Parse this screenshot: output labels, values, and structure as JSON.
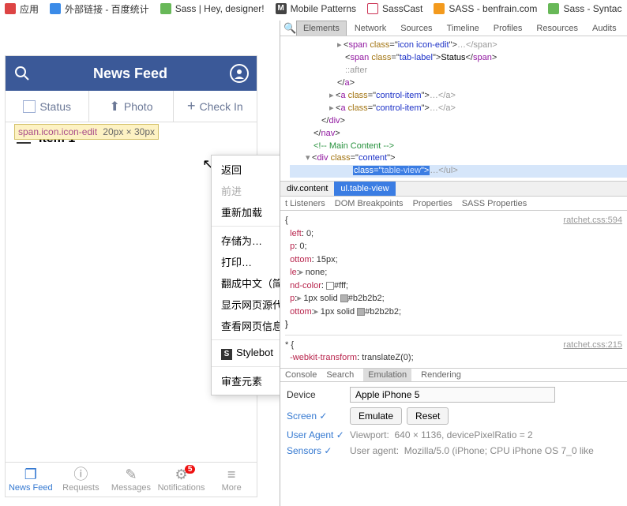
{
  "bookmarks": [
    {
      "color": "#d44",
      "label": "应用"
    },
    {
      "color": "#3b8be8",
      "label": "外部链接 - 百度统计"
    },
    {
      "color": "#68b858",
      "label": "Sass | Hey, designer!"
    },
    {
      "color": "#444",
      "label": "Mobile Patterns",
      "letter": "M"
    },
    {
      "color": "#c35",
      "label": "SassCast"
    },
    {
      "color": "#f39a1d",
      "label": "SASS - benfrain.com"
    },
    {
      "color": "#68b858",
      "label": "Sass - Syntac"
    }
  ],
  "phone": {
    "title": "News Feed",
    "seg": [
      "Status",
      "Photo",
      "Check In"
    ],
    "sel_tooltip_tag": "span.icon.icon-edit",
    "sel_tooltip_dim": "20px × 30px",
    "item": "Item 1",
    "tabs": [
      "News Feed",
      "Requests",
      "Messages",
      "Notifications",
      "More"
    ],
    "badge": "5"
  },
  "ctx": {
    "back": "返回",
    "forward": "前进",
    "reload": "重新加载",
    "saveas": "存储为…",
    "print": "打印…",
    "translate": "翻成中文（简体中文）",
    "viewsrc": "显示网页源代码",
    "pageinfo": "查看网页信息",
    "stylebot": "Stylebot",
    "inspect": "审查元素"
  },
  "dt": {
    "tabs": [
      "Elements",
      "Network",
      "Sources",
      "Timeline",
      "Profiles",
      "Resources",
      "Audits"
    ],
    "dom": {
      "l1a": "<span class=\"icon icon-edit\">",
      "l1b": "…</span>",
      "l2a": "<span class=\"tab-label\">",
      "l2b": "Status",
      "l2c": "</span>",
      "l3": "::after",
      "l4": "</a>",
      "l5a": "<a class=\"control-item\">",
      "l5b": "…</a>",
      "l6": "</div>",
      "l7": "</nav>",
      "l8": "<!-- Main Content -->",
      "l9a": "<div class=\"content\">",
      "l10a": "class=\"table-view\">",
      "l10b": "…</ul>"
    },
    "crumbs": [
      "div.content",
      "ul.table-view"
    ],
    "style_tabs": [
      "t Listeners",
      "DOM Breakpoints",
      "Properties",
      "SASS Properties"
    ],
    "css1": {
      "src": "ratchet.css:594",
      "sel": "{",
      "p1": "left",
      "v1": "0;",
      "p2": "p",
      "v2": "0;",
      "p3": "ottom",
      "v3": "15px;",
      "p4": "le",
      "v4": "none;",
      "p5": "nd-color",
      "v5": "#fff;",
      "p6": "p",
      "v6": "1px solid",
      "v6b": "#b2b2b2;",
      "p7": "ottom",
      "v7": "1px solid",
      "v7b": "#b2b2b2;"
    },
    "css2": {
      "src": "ratchet.css:215",
      "sel": "* {",
      "p1": "-webkit-transform",
      "v1": "translateZ(0);"
    },
    "drawer_tabs": [
      "Console",
      "Search",
      "Emulation",
      "Rendering"
    ],
    "emu": {
      "device_lab": "Device",
      "device_val": "Apple iPhone 5",
      "screen": "Screen",
      "ua": "User Agent",
      "sensors": "Sensors",
      "emulate": "Emulate",
      "reset": "Reset",
      "viewport_lab": "Viewport:",
      "viewport_val": "640 × 1136, devicePixelRatio = 2",
      "ua_lab": "User agent:",
      "ua_val": "Mozilla/5.0 (iPhone; CPU iPhone OS 7_0 like"
    }
  }
}
